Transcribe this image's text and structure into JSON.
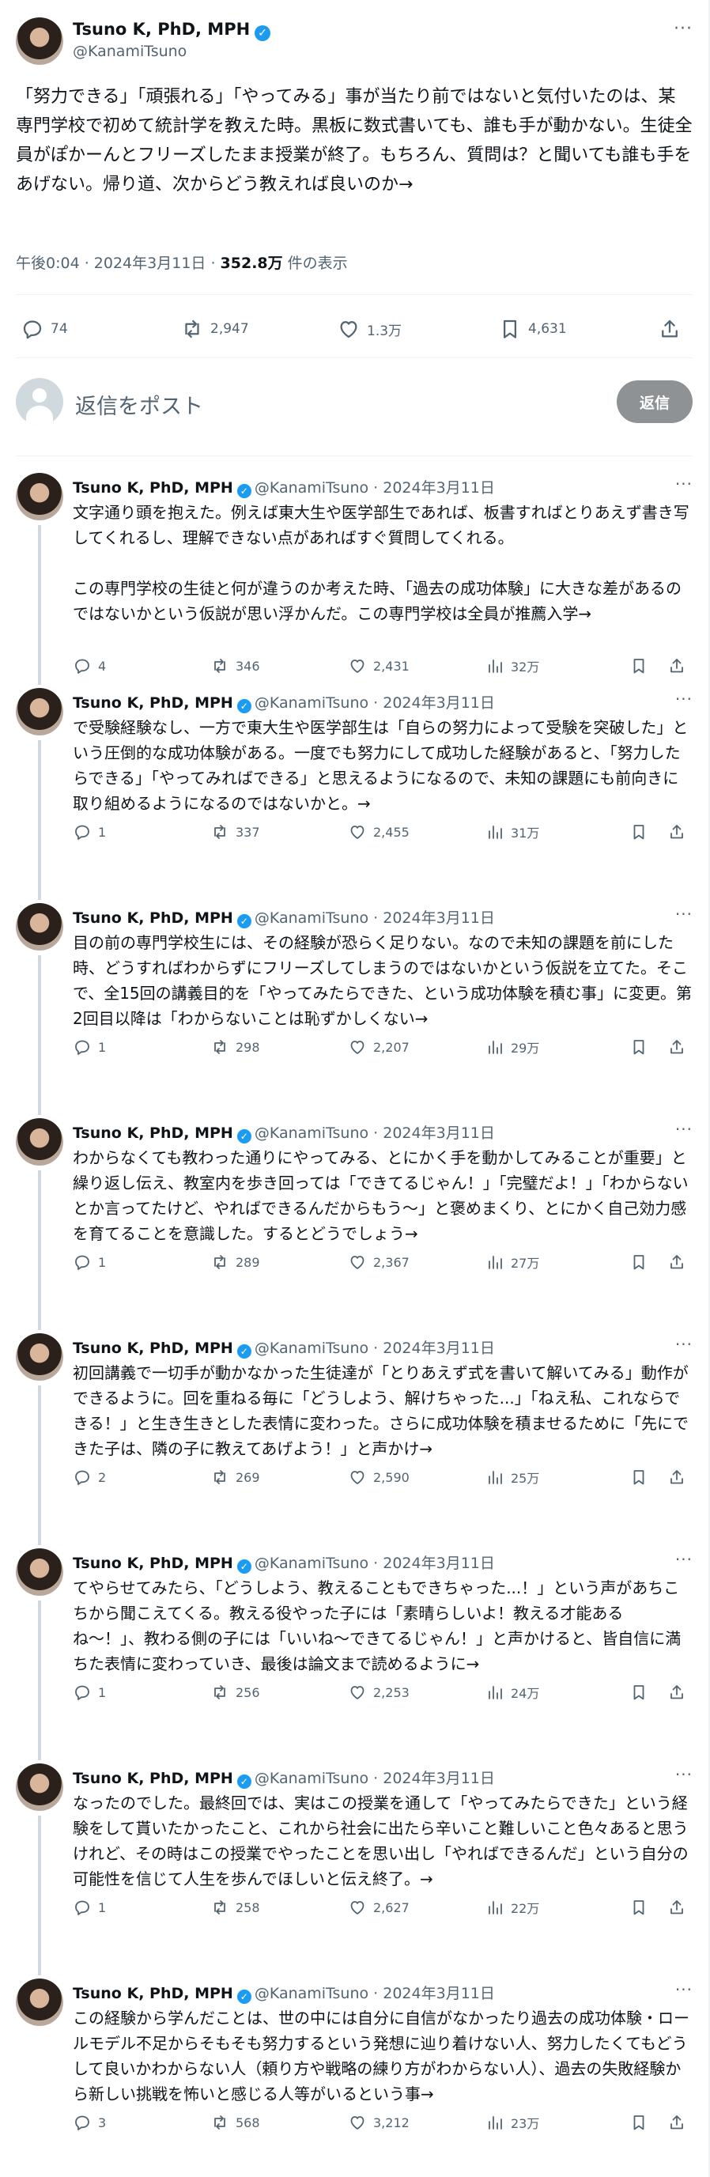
{
  "author": {
    "name": "Tsuno K, PhD, MPH",
    "handle": "@KanamiTsuno",
    "verified_mark": "✓"
  },
  "main_post": {
    "text": "「努力できる」「頑張れる」「やってみる」事が当たり前ではないと気付いたのは、某専門学校で初めて統計学を教えた時。黒板に数式書いても、誰も手が動かない。生徒全員がぽかーんとフリーズしたまま授業が終了。もちろん、質問は？と聞いても誰も手をあげない。帰り道、次からどう教えれば良いのか→",
    "time": "午後0:04 · 2024年3月11日 · ",
    "views": "352.8万",
    "views_suffix": " 件の表示",
    "replies": "74",
    "reposts": "2,947",
    "likes": "1.3万",
    "bookmarks": "4,631"
  },
  "compose": {
    "placeholder": "返信をポスト",
    "button": "返信"
  },
  "more_label": "···",
  "dot": " · ",
  "replies": [
    {
      "date": "2024年3月11日",
      "text": "文字通り頭を抱えた。例えば東大生や医学部生であれば、板書すればとりあえず書き写してくれるし、理解できない点があればすぐ質問してくれる。\n\nこの専門学校の生徒と何が違うのか考えた時、「過去の成功体験」に大きな差があるのではないかという仮説が思い浮かんだ。この専門学校は全員が推薦入学→",
      "replies": "4",
      "reposts": "346",
      "likes": "2,431",
      "views": "32万"
    },
    {
      "date": "2024年3月11日",
      "text": "で受験経験なし、一方で東大生や医学部生は「自らの努力によって受験を突破した」という圧倒的な成功体験がある。一度でも努力にして成功した経験があると、「努力したらできる」「やってみればできる」と思えるようになるので、未知の課題にも前向きに取り組めるようになるのではないかと。→",
      "replies": "1",
      "reposts": "337",
      "likes": "2,455",
      "views": "31万"
    },
    {
      "date": "2024年3月11日",
      "text": "目の前の専門学校生には、その経験が恐らく足りない。なので未知の課題を前にした時、どうすればわからずにフリーズしてしまうのではないかという仮説を立てた。そこで、全15回の講義目的を「やってみたらできた、という成功体験を積む事」に変更。第2回目以降は「わからないことは恥ずかしくない→",
      "replies": "1",
      "reposts": "298",
      "likes": "2,207",
      "views": "29万"
    },
    {
      "date": "2024年3月11日",
      "text": "わからなくても教わった通りにやってみる、とにかく手を動かしてみることが重要」と繰り返し伝え、教室内を歩き回っては「できてるじゃん！」「完璧だよ！」「わからないとか言ってたけど、やればできるんだからもう〜」と褒めまくり、とにかく自己効力感を育てることを意識した。するとどうでしょう→",
      "replies": "1",
      "reposts": "289",
      "likes": "2,367",
      "views": "27万"
    },
    {
      "date": "2024年3月11日",
      "text": "初回講義で一切手が動かなかった生徒達が「とりあえず式を書いて解いてみる」動作ができるように。回を重ねる毎に「どうしよう、解けちゃった...」「ねえ私、これならできる！」と生き生きとした表情に変わった。さらに成功体験を積ませるために「先にできた子は、隣の子に教えてあげよう！」と声かけ→",
      "replies": "2",
      "reposts": "269",
      "likes": "2,590",
      "views": "25万"
    },
    {
      "date": "2024年3月11日",
      "text": "てやらせてみたら、「どうしよう、教えることもできちゃった...！」という声があちこちから聞こえてくる。教える役やった子には「素晴らしいよ！教える才能あるね〜！」、教わる側の子には「いいね〜できてるじゃん！」と声かけると、皆自信に満ちた表情に変わっていき、最後は論文まで読めるように→",
      "replies": "1",
      "reposts": "256",
      "likes": "2,253",
      "views": "24万"
    },
    {
      "date": "2024年3月11日",
      "text": "なったのでした。最終回では、実はこの授業を通して「やってみたらできた」という経験をして貰いたかったこと、これから社会に出たら辛いこと難しいこと色々あると思うけれど、その時はこの授業でやったことを思い出し「やればできるんだ」という自分の可能性を信じて人生を歩んでほしいと伝え終了。→",
      "replies": "1",
      "reposts": "258",
      "likes": "2,627",
      "views": "22万"
    },
    {
      "date": "2024年3月11日",
      "text": "この経験から学んだことは、世の中には自分に自信がなかったり過去の成功体験・ロールモデル不足からそもそも努力するという発想に辿り着けない人、努力したくてもどうして良いかわからない人（頼り方や戦略の練り方がわからない人）、過去の失敗経験から新しい挑戦を怖いと感じる人等がいるという事→",
      "replies": "3",
      "reposts": "568",
      "likes": "3,212",
      "views": "23万"
    }
  ]
}
